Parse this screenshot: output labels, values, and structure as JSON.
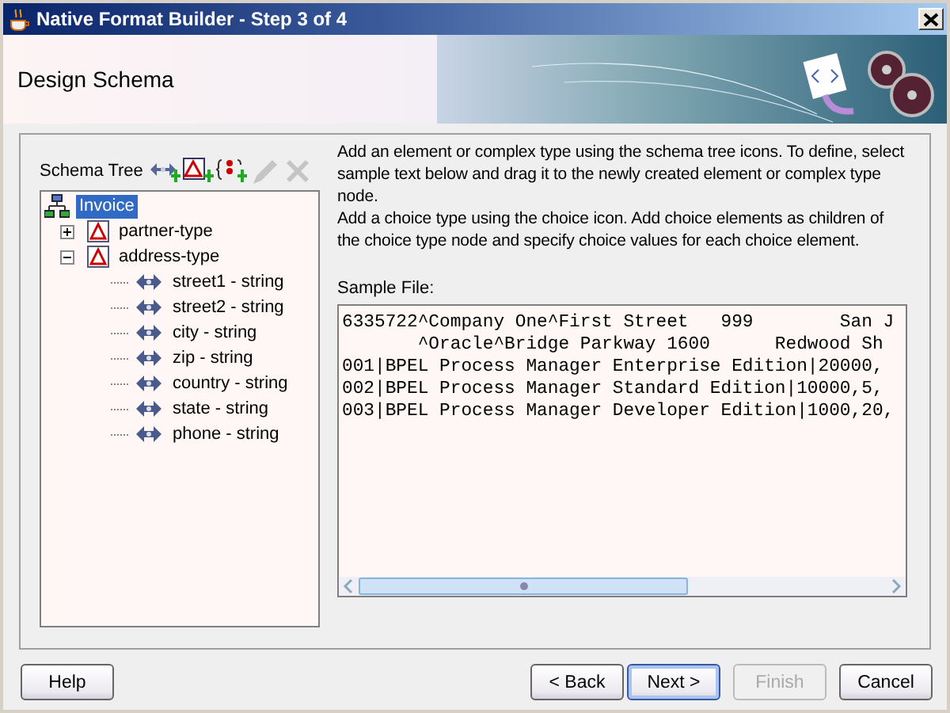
{
  "window": {
    "title": "Native Format Builder - Step 3 of 4"
  },
  "header": {
    "title": "Design Schema"
  },
  "schema_tree": {
    "label": "Schema Tree",
    "toolbar": [
      {
        "kind": "add-element",
        "disabled": false
      },
      {
        "kind": "add-complex",
        "disabled": false
      },
      {
        "kind": "add-choice",
        "disabled": false
      },
      {
        "kind": "edit",
        "disabled": true
      },
      {
        "kind": "delete",
        "disabled": true
      }
    ],
    "items": [
      {
        "label": "Invoice",
        "kind": "root",
        "selected": true,
        "expanded": true,
        "children": [
          {
            "label": "partner-type",
            "kind": "complex",
            "selected": false,
            "expanded": false
          },
          {
            "label": "address-type",
            "kind": "complex",
            "selected": false,
            "expanded": true,
            "children": [
              {
                "label": "street1 - string",
                "kind": "element",
                "selected": false
              },
              {
                "label": "street2 - string",
                "kind": "element",
                "selected": false
              },
              {
                "label": "city - string",
                "kind": "element",
                "selected": false
              },
              {
                "label": "zip - string",
                "kind": "element",
                "selected": false
              },
              {
                "label": "country - string",
                "kind": "element",
                "selected": false
              },
              {
                "label": "state - string",
                "kind": "element",
                "selected": false
              },
              {
                "label": "phone - string",
                "kind": "element",
                "selected": false
              }
            ]
          }
        ]
      }
    ]
  },
  "instructions": [
    "Add an element or complex type using the schema tree icons. To define, select sample text below and drag it to the newly created element or complex type node.",
    "Add a choice type using the choice icon. Add choice elements as children of the choice type node and specify choice values for each choice element."
  ],
  "sample_file": {
    "label": "Sample File:",
    "lines": [
      "6335722^Company One^First Street   999        San J",
      "       ^Oracle^Bridge Parkway 1600      Redwood Sh",
      "001|BPEL Process Manager Enterprise Edition|20000,",
      "002|BPEL Process Manager Standard Edition|10000,5,",
      "003|BPEL Process Manager Developer Edition|1000,20,"
    ]
  },
  "buttons": [
    {
      "label": "Help",
      "kind": "help",
      "default": false,
      "disabled": false
    },
    {
      "label": "< Back",
      "kind": "nav",
      "default": false,
      "disabled": false
    },
    {
      "label": "Next >",
      "kind": "nav",
      "default": true,
      "disabled": false
    },
    {
      "label": "Finish",
      "kind": "nav",
      "default": false,
      "disabled": true
    },
    {
      "label": "Cancel",
      "kind": "nav",
      "default": false,
      "disabled": false
    }
  ]
}
